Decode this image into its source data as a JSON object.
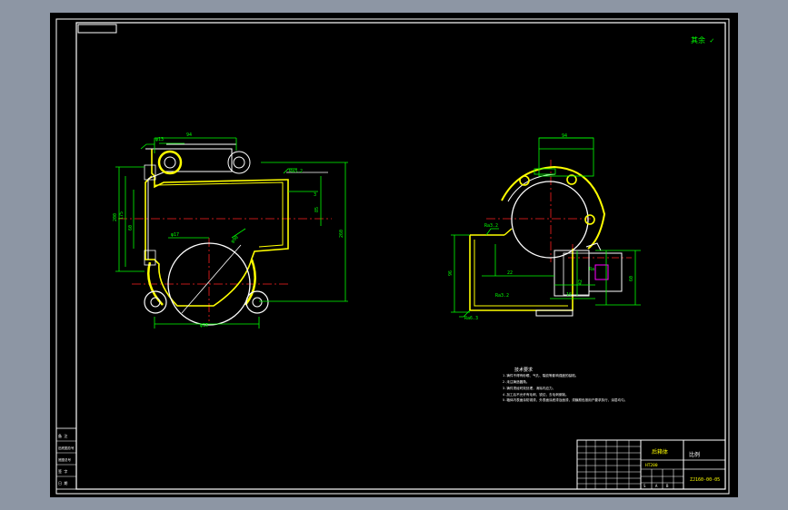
{
  "roughness_note": "其余 ✓",
  "tech_requirements": {
    "title": "技术要求",
    "lines": [
      "1.铸件不得有砂眼、气孔、裂纹等影响强度的缺陷。",
      "2.未注铸造圆角。",
      "3.铸件须经时效处理，消除内应力。",
      "4.加工后不允许有毛刺、锐边，去毛刺倒钝。",
      "5.箱体内表面涂防锈漆，外表面涂底漆及面漆，漆膜颜色按用户要求执行，涂层均匀。"
    ]
  },
  "title_block": {
    "part_name": "后箱体",
    "scale_label": "比例",
    "drawing_number": "ZJ160-00-05",
    "material": "HT200",
    "stage_labels": [
      "S",
      "A",
      "B"
    ]
  },
  "side_stamp": {
    "rows": [
      "备  注",
      "旧底图总号",
      "底图总号",
      "签 字",
      "日 期"
    ]
  },
  "colors": {
    "background": "#000000",
    "outline": "#ffffff",
    "dimension": "#00ff00",
    "centerline": "#ff2020",
    "hatch": "#ffff00",
    "hidden": "#ff00ff"
  }
}
